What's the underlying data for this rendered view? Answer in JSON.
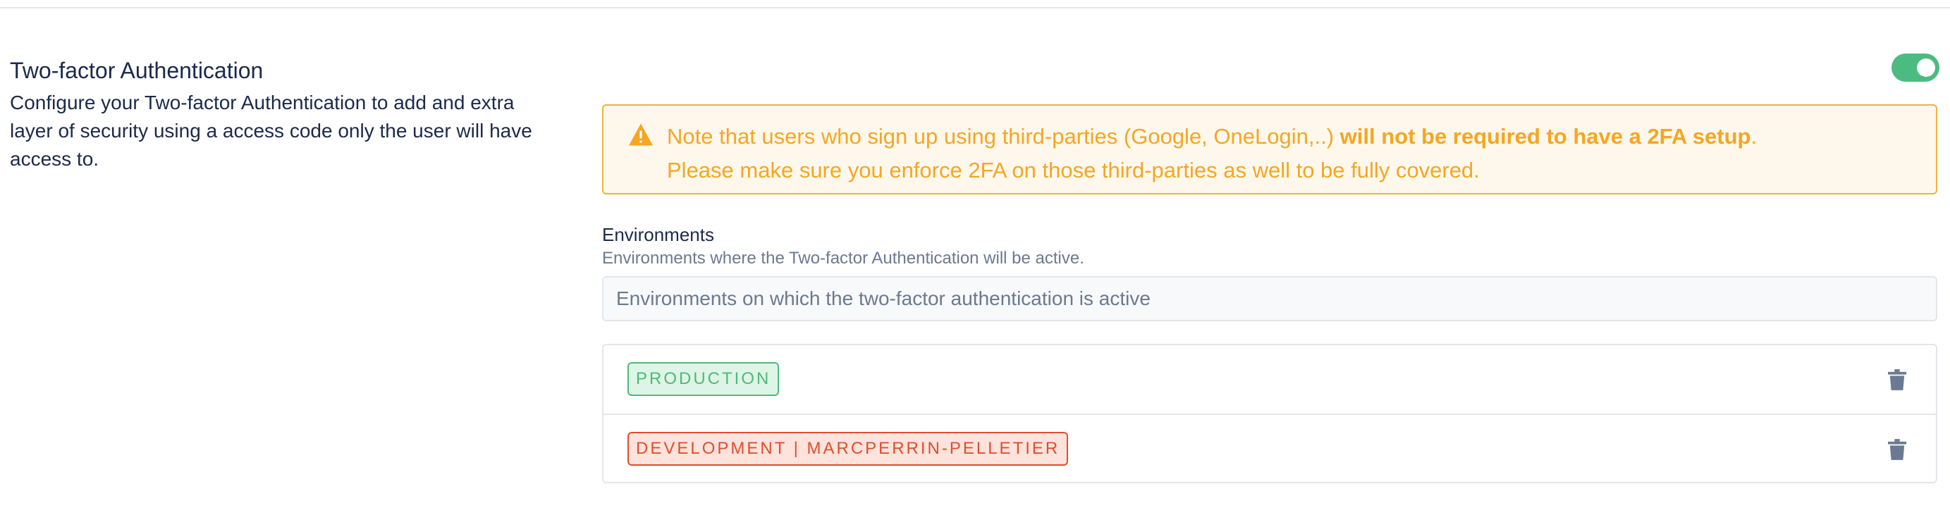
{
  "section": {
    "title": "Two-factor Authentication",
    "description": "Configure your Two-factor Authentication to add and extra layer of security using a access code only the user will have access to.",
    "toggle_enabled": true
  },
  "warning": {
    "text_before": "Note that users who sign up using third-parties (Google, OneLogin,..) ",
    "text_bold": "will not be required to have a 2FA setup",
    "text_after": ".",
    "line2": "Please make sure you enforce 2FA on those third-parties as well to be fully covered.",
    "icon": "warning-triangle-icon"
  },
  "environments": {
    "label": "Environments",
    "help": "Environments where the Two-factor Authentication will be active.",
    "placeholder": "Environments on which the two-factor authentication is active",
    "items": [
      {
        "label": "PRODUCTION",
        "color": "#52b87a"
      },
      {
        "label": "DEVELOPMENT | MARCPERRIN-PELLETIER",
        "color": "#e04e2c"
      }
    ]
  },
  "colors": {
    "accent_green": "#4cbb7f",
    "warning": "#f5a623",
    "text_primary": "#1b2a4a",
    "text_muted": "#6b7a90"
  }
}
